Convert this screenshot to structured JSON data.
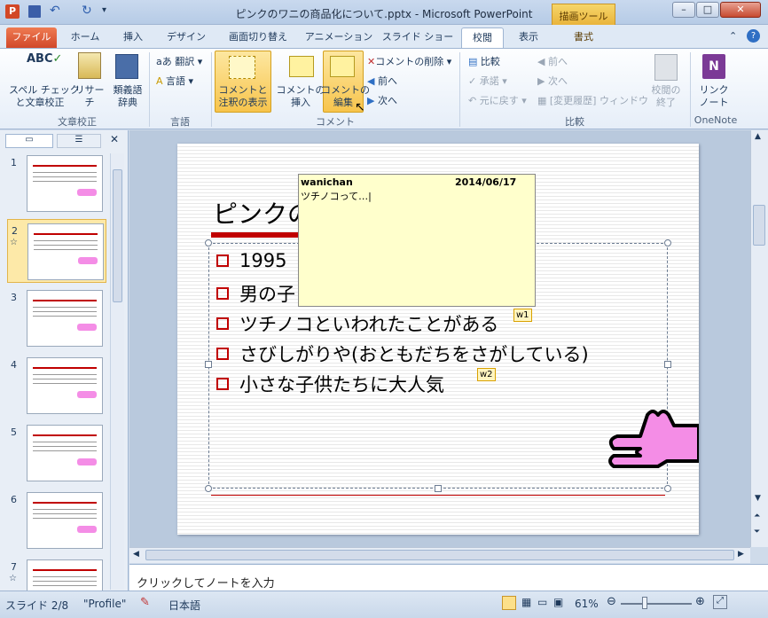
{
  "window": {
    "title": "ピンクのワニの商品化について.pptx - Microsoft PowerPoint",
    "contextual_tab": "描画ツール",
    "contextual_subtab": "書式"
  },
  "tabs": [
    "ファイル",
    "ホーム",
    "挿入",
    "デザイン",
    "画面切り替え",
    "アニメーション",
    "スライド ショー",
    "校閲",
    "表示"
  ],
  "active_tab": "校閲",
  "ribbon": {
    "proofing": {
      "label": "文章校正",
      "spell": "スペル チェック\nと文章校正",
      "research": "リサーチ",
      "thesaurus": "類義語\n辞典"
    },
    "language": {
      "label": "言語",
      "translate": "翻訳",
      "language": "言語"
    },
    "comments": {
      "label": "コメント",
      "show": "コメントと\n注釈の表示",
      "new": "コメントの\n挿入",
      "edit": "コメントの\n編集",
      "delete": "コメントの削除",
      "prev": "前へ",
      "next": "次へ"
    },
    "compare": {
      "label": "比較",
      "compare": "比較",
      "accept": "承諾",
      "reject": "元に戻す",
      "panel": "[変更履歴] ウィンドウ",
      "prev": "前へ",
      "next": "次へ",
      "end": "校閲の\n終了"
    },
    "onenote": {
      "label": "OneNote",
      "linked": "リンク\nノート"
    }
  },
  "thumbnails": [
    {
      "num": "1",
      "star": ""
    },
    {
      "num": "2",
      "star": "☆"
    },
    {
      "num": "3",
      "star": ""
    },
    {
      "num": "4",
      "star": ""
    },
    {
      "num": "5",
      "star": ""
    },
    {
      "num": "6",
      "star": ""
    },
    {
      "num": "7",
      "star": "☆"
    }
  ],
  "slide": {
    "title": "ピンクの",
    "bullets": [
      "1995",
      "男の子",
      "ツチノコといわれたことがある",
      "さびしがりや(おともだちをさがしている)",
      "小さな子供たちに大人気"
    ]
  },
  "comment": {
    "author": "wanichan",
    "date": "2014/06/17",
    "text": "ツチノコって…|",
    "marker1": "w1",
    "marker2": "w2"
  },
  "notes_placeholder": "クリックしてノートを入力",
  "status": {
    "slide": "スライド 2/8",
    "theme": "\"Profile\"",
    "language": "日本語",
    "zoom": "61%"
  },
  "colors": {
    "accent": "#c00000",
    "file_tab": "#d1482a",
    "comment_bg": "#ffffcc",
    "crocodile": "#f48de6"
  }
}
